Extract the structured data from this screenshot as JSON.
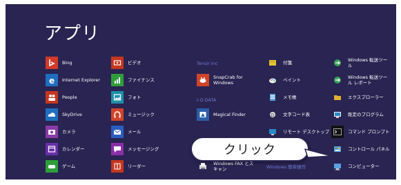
{
  "title": "アプリ",
  "colors": {
    "background": "#2a2452",
    "tile_red": "#d23a2a",
    "tile_blue": "#1f6fc0",
    "tile_green": "#2f9e3a",
    "tile_purple": "#7a3aa0",
    "tile_navy": "#2b5da8",
    "group_label": "#6f7ad0"
  },
  "columns": [
    {
      "items": [
        {
          "label": "Bing",
          "icon": "bing-icon",
          "color": "#d23a2a"
        },
        {
          "label": "Internet Explorer",
          "icon": "internet-explorer-icon",
          "color": "#1f6fc0"
        },
        {
          "label": "People",
          "icon": "people-icon",
          "color": "#c5361f"
        },
        {
          "label": "SkyDrive",
          "icon": "cloud-icon",
          "color": "#1f6fc0"
        },
        {
          "label": "カメラ",
          "icon": "camera-icon",
          "color": "#8a3aa8"
        },
        {
          "label": "カレンダー",
          "icon": "calendar-icon",
          "color": "#6a2fa8"
        },
        {
          "label": "ゲーム",
          "icon": "game-icon",
          "color": "#2f9e3a"
        }
      ]
    },
    {
      "items": [
        {
          "label": "ビデオ",
          "icon": "video-icon",
          "color": "#c5361f"
        },
        {
          "label": "ファイナンス",
          "icon": "finance-icon",
          "color": "#2f9e3a"
        },
        {
          "label": "フォト",
          "icon": "photo-icon",
          "color": "#1f8fa8"
        },
        {
          "label": "ミュージック",
          "icon": "headphones-icon",
          "color": "#d0442a"
        },
        {
          "label": "メール",
          "icon": "mail-icon",
          "color": "#2a5ec0"
        },
        {
          "label": "メッセージング",
          "icon": "messaging-icon",
          "color": "#8a2fa8"
        },
        {
          "label": "リーダー",
          "icon": "reader-icon",
          "color": "#c5361f"
        }
      ]
    },
    {
      "groups": [
        {
          "label": "Tensir Inc"
        },
        {
          "label": "I-O DATA"
        }
      ],
      "items": [
        {
          "label": "SnapCrab for\nWindows",
          "icon": "snapcrab-icon",
          "color": "#d0442a"
        },
        {
          "label": "Magical Finder",
          "icon": "magical-finder-icon",
          "color": "#2b5da8"
        },
        {
          "label": "Windows FAX とス\nキャン",
          "icon": "fax-icon",
          "color": "#ffffff"
        }
      ]
    },
    {
      "groups": [
        {
          "label": "Windows 簡単操作"
        }
      ],
      "items": [
        {
          "label": "付箋",
          "icon": "sticky-note-icon",
          "color": "#e3c332"
        },
        {
          "label": "ペイント",
          "icon": "paint-icon",
          "color": "#ffffff"
        },
        {
          "label": "メモ帳",
          "icon": "notepad-icon",
          "color": "#5aa0e0"
        },
        {
          "label": "文字コード表",
          "icon": "character-map-icon",
          "color": "#ffffff"
        },
        {
          "label": "リモート デスクトップ",
          "icon": "remote-desktop-icon",
          "color": "#2a88c8"
        }
      ]
    },
    {
      "items": [
        {
          "label": "Windows 転送ツー\nル",
          "icon": "transfer-tool-icon",
          "color": "#3aa05a"
        },
        {
          "label": "Windows 転送ツー\nル レポート",
          "icon": "transfer-report-icon",
          "color": "#3aa05a"
        },
        {
          "label": "エクスプローラー",
          "icon": "folder-icon",
          "color": "#e0b030"
        },
        {
          "label": "既定のプログラム",
          "icon": "default-programs-icon",
          "color": "#ffffff"
        },
        {
          "label": "コマンド プロンプト",
          "icon": "command-prompt-icon",
          "color": "#111111"
        },
        {
          "label": "コントロール パネル",
          "icon": "control-panel-icon",
          "color": "#5aa0e0"
        },
        {
          "label": "コンピューター",
          "icon": "computer-icon",
          "color": "#5aa0e0"
        }
      ]
    }
  ],
  "callout": {
    "text": "クリック"
  }
}
